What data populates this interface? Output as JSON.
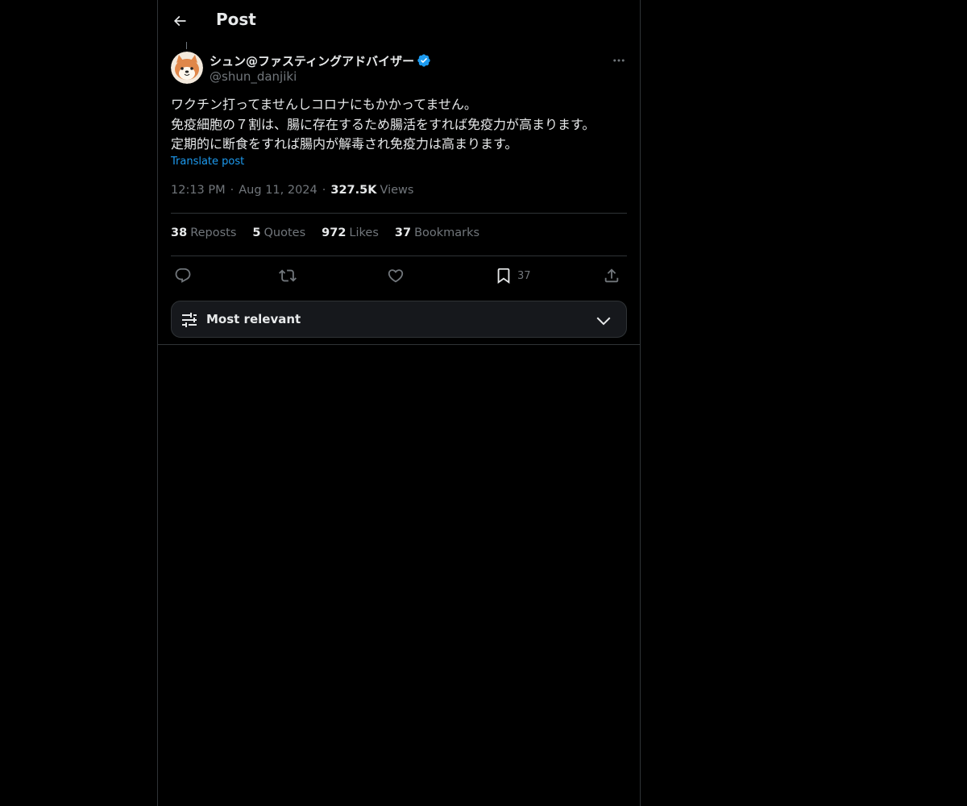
{
  "header": {
    "title": "Post"
  },
  "post": {
    "author": {
      "display_name": "シュン@ファスティングアドバイザー",
      "handle": "@shun_danjiki",
      "verified": true
    },
    "body_lines": [
      "ワクチン打ってませんしコロナにもかかってません。",
      "免疫細胞の７割は、腸に存在するため腸活をすれば免疫力が高まります。",
      "定期的に断食をすれば腸内が解毒され免疫力は高まります。"
    ],
    "translate_label": "Translate post",
    "time": "12:13 PM",
    "separator": "·",
    "date": "Aug 11, 2024",
    "views_count": "327.5K",
    "views_label": "Views",
    "stats": {
      "reposts": {
        "count": "38",
        "label": "Reposts"
      },
      "quotes": {
        "count": "5",
        "label": "Quotes"
      },
      "likes": {
        "count": "972",
        "label": "Likes"
      },
      "bookmarks": {
        "count": "37",
        "label": "Bookmarks"
      }
    },
    "actions": {
      "reply_icon": "reply-icon",
      "repost_icon": "repost-icon",
      "like_icon": "heart-icon",
      "bookmark_icon": "bookmark-icon",
      "bookmark_count": "37",
      "share_icon": "share-icon"
    }
  },
  "sort": {
    "label": "Most relevant",
    "icon": "sliders-icon",
    "chevron": "chevron-down-icon"
  },
  "colors": {
    "background": "#000000",
    "text": "#e7e9ea",
    "secondary_text": "#71767b",
    "accent": "#1d9bf0",
    "border": "#2f3336"
  }
}
